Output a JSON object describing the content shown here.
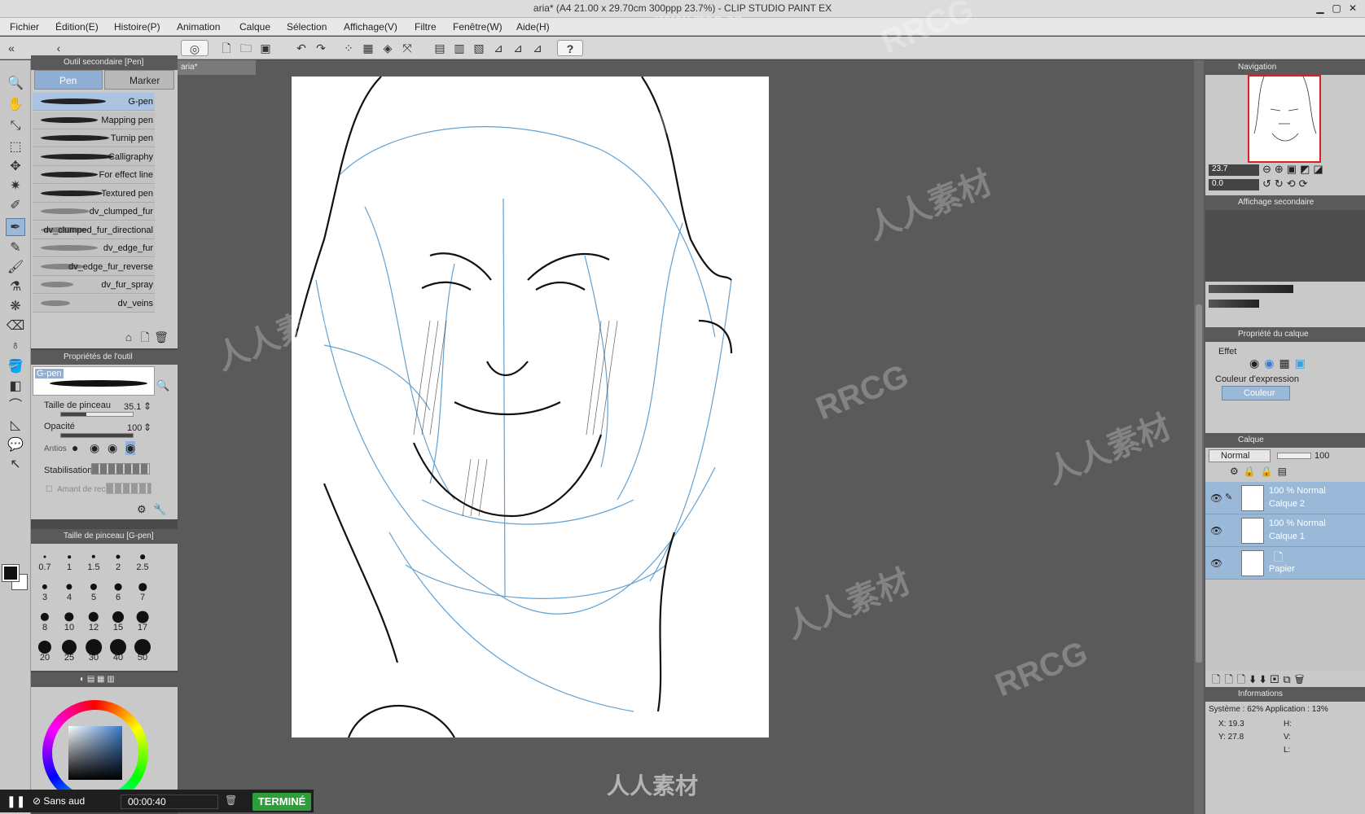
{
  "window": {
    "title": "aria* (A4 21.00 x 29.70cm 300ppp 23.7%)  - CLIP STUDIO PAINT EX"
  },
  "menu": [
    "Fichier",
    "Édition(E)",
    "Histoire(P)",
    "Animation",
    "Calque",
    "Sélection",
    "Affichage(V)",
    "Filtre",
    "Fenêtre(W)",
    "Aide(H)"
  ],
  "doc_tab": "aria*",
  "subtool": {
    "header": "Outil secondaire [Pen]",
    "tabs": [
      "Pen",
      "Marker"
    ],
    "brushes": [
      "G-pen",
      "Mapping pen",
      "Turnip pen",
      "Calligraphy",
      "For effect line",
      "Textured pen",
      "dv_clumped_fur",
      "dv_clumped_fur_directional",
      "dv_edge_fur",
      "dv_edge_fur_reverse",
      "dv_fur_spray",
      "dv_veins"
    ]
  },
  "tool_props": {
    "header": "Propriétés de l'outil",
    "brush_name": "G-pen",
    "size_label": "Taille de pinceau",
    "size_value": "35.1",
    "size_fraction": 0.35,
    "opacity_label": "Opacité",
    "opacity_value": "100",
    "opacity_fraction": 1.0,
    "antialias_label": "Antios",
    "stabilization_label": "Stabilisation",
    "extra_label": "Amant de reche"
  },
  "brush_size": {
    "header": "Taille de pinceau [G-pen]",
    "sizes": [
      "0.7",
      "1",
      "1.5",
      "2",
      "2.5",
      "3",
      "4",
      "5",
      "6",
      "7",
      "8",
      "10",
      "12",
      "15",
      "17",
      "20",
      "25",
      "30",
      "40",
      "50"
    ]
  },
  "navigation": {
    "header": "Navigation",
    "zoom": "23.7",
    "rotation": "0.0"
  },
  "sub_view": {
    "header": "Affichage secondaire"
  },
  "layer_property": {
    "header": "Propriété du calque",
    "effect_label": "Effet",
    "color_label": "Couleur d'expression",
    "color_value": "Couleur"
  },
  "layers": {
    "header": "Calque",
    "blend_mode": "Normal",
    "opacity": "100",
    "items": [
      {
        "line1": "100 % Normal",
        "line2": "Calque 2"
      },
      {
        "line1": "100 % Normal",
        "line2": "Calque 1"
      },
      {
        "line1": "",
        "line2": "Papier"
      }
    ]
  },
  "info": {
    "header": "Informations",
    "system": "Système : 62%  Application :  13%",
    "x": "X: 19.3",
    "y": "Y: 27.8",
    "h": "H:",
    "v": "V:",
    "l": "L:"
  },
  "recorder": {
    "mute": "Sans aud",
    "time": "00:00:40",
    "done": "TERMINÉ"
  },
  "watermarks": {
    "site": "www.rrcg.cn",
    "brand": "人人素材",
    "marks": [
      "RRCG",
      "人人素材",
      "RRCG",
      "人人素材",
      "RRCG",
      "人人素材",
      "RRCG",
      "人人素材"
    ]
  },
  "colors": {
    "accent_blue": "#8fb0d4",
    "done_green": "#2e9e3a",
    "nav_frame": "#e02020"
  }
}
